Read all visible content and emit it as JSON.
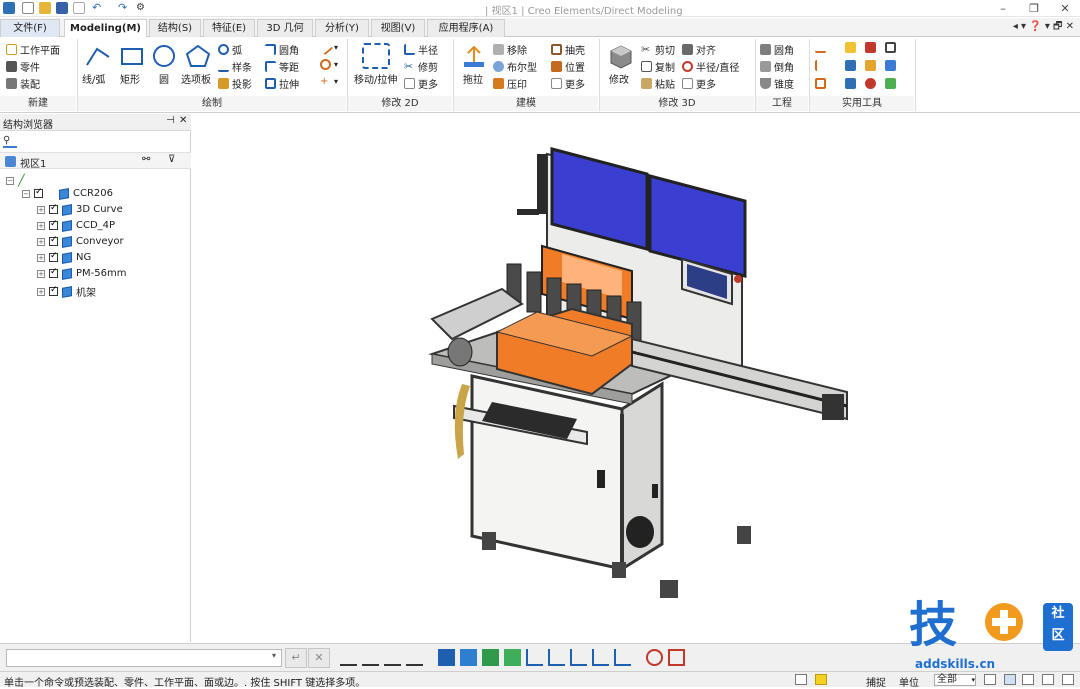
{
  "window": {
    "title": "| 视区1 |  Creo Elements/Direct Modeling"
  },
  "tabs": [
    {
      "label": "文件(F)"
    },
    {
      "label": "Modeling(M)"
    },
    {
      "label": "结构(S)"
    },
    {
      "label": "特征(E)"
    },
    {
      "label": "3D 几何"
    },
    {
      "label": "分析(Y)"
    },
    {
      "label": "视图(V)"
    },
    {
      "label": "应用程序(A)"
    }
  ],
  "ribbon": {
    "new_group": {
      "items": [
        "工作平面",
        "零件",
        "装配"
      ],
      "label": "新建"
    },
    "draw_group": {
      "big": [
        "线/弧",
        "矩形",
        "圆",
        "选项板"
      ],
      "small": [
        "弧",
        "样条",
        "投影",
        "圆角",
        "等距",
        "拉伸"
      ],
      "label": "绘制"
    },
    "modify2d_group": {
      "big": "移动/拉伸",
      "small": [
        "半径",
        "修剪",
        "更多"
      ],
      "label": "修改 2D"
    },
    "model_group": {
      "big": "拖拉",
      "small": [
        "移除",
        "布尔型",
        "压印",
        "抽壳",
        "位置",
        "更多"
      ],
      "label": "建模"
    },
    "modify3d_group": {
      "big": "修改",
      "small": [
        "剪切",
        "对齐",
        "复制",
        "半径/直径",
        "粘贴",
        "更多"
      ],
      "label": "修改 3D"
    },
    "engineering_group": {
      "small": [
        "圆角",
        "倒角",
        "锥度"
      ],
      "label": "工程"
    },
    "tools_group": {
      "label": "实用工具"
    }
  },
  "structure_browser": {
    "title": "结构浏览器",
    "viewport_item": "视区1",
    "root": "CCR206",
    "children": [
      "3D Curve",
      "CCD_4P",
      "Conveyor",
      "NG",
      "PM-56mm",
      "机架"
    ]
  },
  "cmdbar": {
    "input_value": ""
  },
  "status": {
    "message": "单击一个命令或预选装配、零件、工作平面、面或边。. 按住 SHIFT 键选择多项。",
    "snap": "捕捉",
    "units": "单位",
    "scope": "全部"
  },
  "logo": {
    "char": "技",
    "side_top": "社",
    "side_bottom": "区",
    "url": "addskills.cn"
  },
  "colors": {
    "accent": "#1f5fb0",
    "orange": "#f07c28",
    "monitor": "#3b3fd1",
    "logo": "#1f6fd1"
  }
}
